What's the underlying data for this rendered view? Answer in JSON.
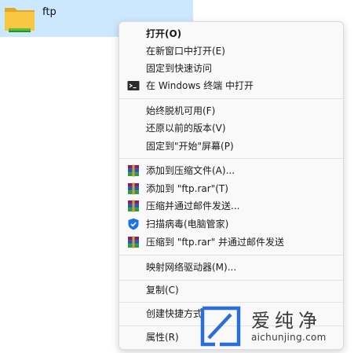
{
  "folder": {
    "name": "ftp",
    "icon": "folder-icon"
  },
  "menu": {
    "items": [
      {
        "label": "打开(O)",
        "icon": ""
      },
      {
        "label": "在新窗口中打开(E)",
        "icon": ""
      },
      {
        "label": "固定到快速访问",
        "icon": ""
      },
      {
        "label": "在 Windows 终端 中打开",
        "icon": "terminal-icon"
      },
      {
        "label": "始终脱机可用(F)",
        "icon": ""
      },
      {
        "label": "还原以前的版本(V)",
        "icon": ""
      },
      {
        "label": "固定到\"开始\"屏幕(P)",
        "icon": ""
      },
      {
        "label": "添加到压缩文件(A)...",
        "icon": "winrar-icon"
      },
      {
        "label": "添加到 \"ftp.rar\"(T)",
        "icon": "winrar-icon"
      },
      {
        "label": "压缩并通过邮件发送...",
        "icon": "winrar-icon"
      },
      {
        "label": "扫描病毒(电脑管家)",
        "icon": "shield-icon"
      },
      {
        "label": "压缩到 \"ftp.rar\" 并通过邮件发送",
        "icon": "winrar-icon"
      },
      {
        "label": "映射网络驱动器(M)...",
        "icon": ""
      },
      {
        "label": "复制(C)",
        "icon": ""
      },
      {
        "label": "创建快捷方式",
        "icon": ""
      },
      {
        "label": "属性(R)",
        "icon": ""
      }
    ]
  },
  "watermark": {
    "title": "爱纯净",
    "url": "aichunjing.com"
  },
  "colors": {
    "selection": "#cce8ff",
    "menu_bg": "#f9f9f9",
    "accent_blue": "#1a73e8"
  }
}
